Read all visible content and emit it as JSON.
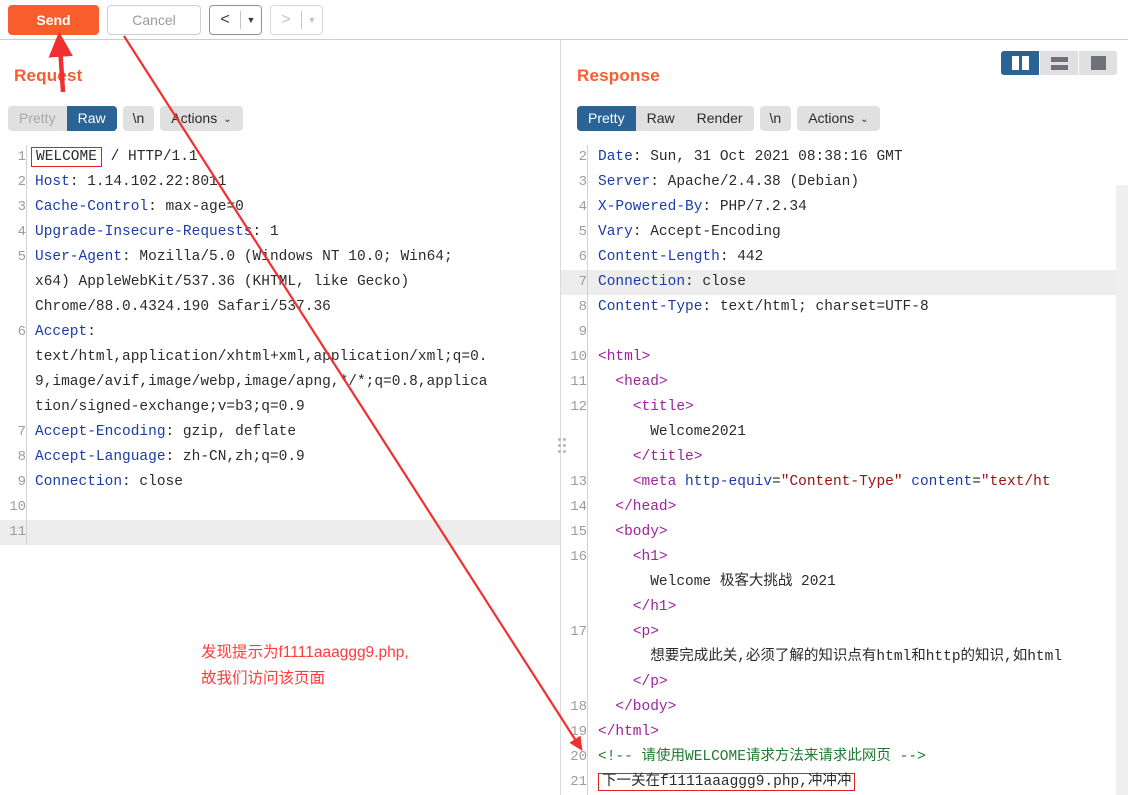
{
  "toolbar": {
    "send_label": "Send",
    "cancel_label": "Cancel",
    "back_icon": "chevron-left-icon",
    "back_caret": "▼",
    "forward_icon": "chevron-right-icon",
    "forward_caret": "▼"
  },
  "request": {
    "title": "Request",
    "tabs": [
      {
        "label": "Pretty",
        "active": false
      },
      {
        "label": "Raw",
        "active": true
      }
    ],
    "newline_chip": "\\n",
    "actions_label": "Actions",
    "actions_caret": "⌄",
    "lines": [
      {
        "n": "1",
        "boxed": "WELCOME",
        "rest": " / HTTP/1.1"
      },
      {
        "n": "2",
        "hdr": "Host",
        "val": " 1.14.102.22:8011"
      },
      {
        "n": "3",
        "hdr": "Cache-Control",
        "val": " max-age=0"
      },
      {
        "n": "4",
        "hdr": "Upgrade-Insecure-Requests",
        "val": " 1"
      },
      {
        "n": "5",
        "hdr": "User-Agent",
        "val": " Mozilla/5.0 (Windows NT 10.0; Win64;"
      },
      {
        "n": "",
        "cont": "x64) AppleWebKit/537.36 (KHTML, like Gecko)"
      },
      {
        "n": "",
        "cont": "Chrome/88.0.4324.190 Safari/537.36"
      },
      {
        "n": "6",
        "hdr": "Accept",
        "val": ""
      },
      {
        "n": "",
        "cont": "text/html,application/xhtml+xml,application/xml;q=0."
      },
      {
        "n": "",
        "cont": "9,image/avif,image/webp,image/apng,*/*;q=0.8,applica"
      },
      {
        "n": "",
        "cont": "tion/signed-exchange;v=b3;q=0.9"
      },
      {
        "n": "7",
        "hdr": "Accept-Encoding",
        "val": " gzip, deflate"
      },
      {
        "n": "8",
        "hdr": "Accept-Language",
        "val": " zh-CN,zh;q=0.9"
      },
      {
        "n": "9",
        "hdr": "Connection",
        "val": " close"
      },
      {
        "n": "10",
        "cont": ""
      },
      {
        "n": "11",
        "cont": "",
        "highlight": true
      }
    ]
  },
  "response": {
    "title": "Response",
    "tabs": [
      {
        "label": "Pretty",
        "active": true
      },
      {
        "label": "Raw",
        "active": false
      },
      {
        "label": "Render",
        "active": false
      }
    ],
    "newline_chip": "\\n",
    "actions_label": "Actions",
    "actions_caret": "⌄",
    "layout_buttons": [
      {
        "icon": "split-view-icon",
        "active": true
      },
      {
        "icon": "stacked-view-icon",
        "active": false
      },
      {
        "icon": "single-view-icon",
        "active": false
      }
    ],
    "lines": [
      {
        "n": "2",
        "hdr": "Date",
        "val": " Sun, 31 Oct 2021 08:38:16 GMT"
      },
      {
        "n": "3",
        "hdr": "Server",
        "val": " Apache/2.4.38 (Debian)"
      },
      {
        "n": "4",
        "hdr": "X-Powered-By",
        "val": " PHP/7.2.34"
      },
      {
        "n": "5",
        "hdr": "Vary",
        "val": " Accept-Encoding"
      },
      {
        "n": "6",
        "hdr": "Content-Length",
        "val": " 442"
      },
      {
        "n": "7",
        "hdr": "Connection",
        "val": " close",
        "highlight": true
      },
      {
        "n": "8",
        "hdr": "Content-Type",
        "val": " text/html; charset=UTF-8"
      },
      {
        "n": "9",
        "plain": ""
      },
      {
        "n": "10",
        "tag": "<html>",
        "indent": 0
      },
      {
        "n": "11",
        "tag": "<head>",
        "indent": 1
      },
      {
        "n": "12",
        "tag": "<title>",
        "indent": 2
      },
      {
        "n": "",
        "text": "Welcome2021",
        "indent": 3
      },
      {
        "n": "",
        "tag": "</title>",
        "indent": 2
      },
      {
        "n": "13",
        "meta": true,
        "indent": 2
      },
      {
        "n": "14",
        "tag": "</head>",
        "indent": 1
      },
      {
        "n": "15",
        "tag": "<body>",
        "indent": 1
      },
      {
        "n": "16",
        "tag": "<h1>",
        "indent": 2
      },
      {
        "n": "",
        "text": "Welcome 极客大挑战 2021",
        "indent": 3
      },
      {
        "n": "",
        "tag": "</h1>",
        "indent": 2
      },
      {
        "n": "17",
        "tag": "<p>",
        "indent": 2
      },
      {
        "n": "",
        "text": "想要完成此关,必须了解的知识点有html和http的知识,如html",
        "indent": 3
      },
      {
        "n": "",
        "tag": "</p>",
        "indent": 2
      },
      {
        "n": "18",
        "tag": "</body>",
        "indent": 1
      },
      {
        "n": "19",
        "tag": "</html>",
        "indent": 0
      },
      {
        "n": "20",
        "comment": "<!-- 请使用WELCOME请求方法来请求此网页 -->",
        "indent": 0
      },
      {
        "n": "21",
        "boxedline": "下一关在f1111aaaggg9.php,冲冲冲",
        "indent": 0
      }
    ],
    "meta_line": {
      "tag_open": "<meta",
      "attr1": "http-equiv",
      "val1": "\"Content-Type\"",
      "attr2": "content",
      "val2": "\"text/ht"
    }
  },
  "annotations": {
    "note_line1": "发现提示为f1111aaaggg9.php,",
    "note_line2": "故我们访问该页面",
    "note_color": "#ff3b3b",
    "arrow_up_name": "arrow-pointing-to-send-button",
    "arrow_diagonal_name": "arrow-pointing-to-comment-line"
  },
  "colors": {
    "accent_orange": "#f95d2c",
    "tab_active_blue": "#2a6496",
    "header_blue": "#1b3ca8",
    "tag_purple": "#a020a0",
    "string_red": "#a01010",
    "comment_green": "#1f7a32",
    "annotation_red": "#ff3b3b"
  }
}
